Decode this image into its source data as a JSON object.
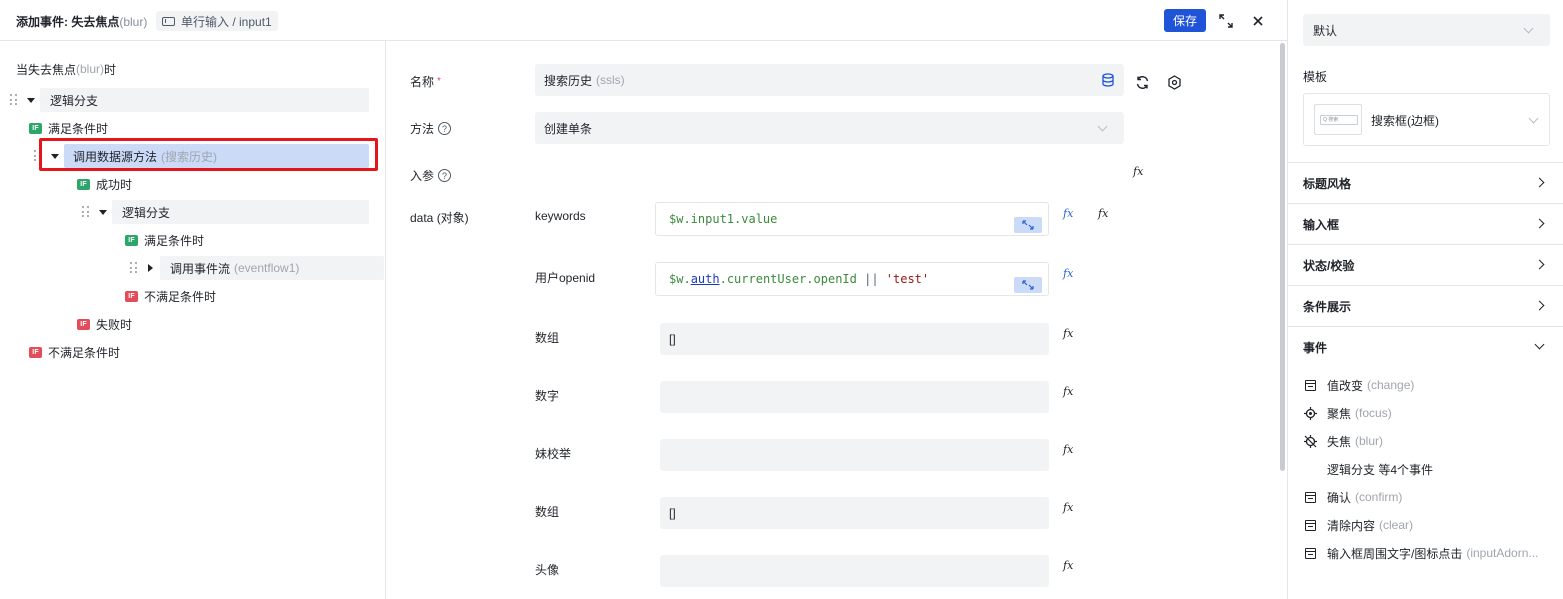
{
  "header": {
    "title": "添加事件: 失去焦点",
    "title_event": "(blur)",
    "context": "单行输入 / input1",
    "save_label": "保存"
  },
  "tree": {
    "heading": "当失去焦点",
    "heading_event": "(blur)",
    "heading_suffix": "时",
    "nodes": {
      "branch1": "逻辑分支",
      "cond_true": "满足条件时",
      "call_ds": "调用数据源方法",
      "call_ds_sub": "(搜索历史)",
      "success": "成功时",
      "branch2": "逻辑分支",
      "cond_true2": "满足条件时",
      "call_flow": "调用事件流",
      "call_flow_sub": "(eventflow1)",
      "cond_false2": "不满足条件时",
      "fail": "失败时",
      "cond_false": "不满足条件时"
    },
    "badge": "IF"
  },
  "form": {
    "name_label": "名称",
    "required_mark": "*",
    "name_value": "搜索历史",
    "name_sub": "(ssls)",
    "method_label": "方法",
    "method_value": "创建单条",
    "params_label": "入参",
    "data_label": "data (对象)",
    "fx": "fx",
    "params": [
      {
        "label": "keywords"
      },
      {
        "label": "用户openid"
      },
      {
        "label": "数组",
        "value": "[]"
      },
      {
        "label": "数字",
        "value": ""
      },
      {
        "label": "妹校举",
        "value": ""
      },
      {
        "label": "数组",
        "value": "[]"
      },
      {
        "label": "头像",
        "value": ""
      }
    ],
    "code_keywords": "$w.input1.value",
    "code_openid_a": "$w.",
    "code_openid_b": "auth",
    "code_openid_c": ".currentUser.openId",
    "code_openid_d": " || ",
    "code_openid_e": "'test'"
  },
  "right": {
    "select_value": "默认",
    "template_label": "模板",
    "template_value": "搜索框(边框)",
    "template_thumb_text": "Q 搜索",
    "sections": [
      "标题风格",
      "输入框",
      "状态/校验",
      "条件展示",
      "事件"
    ],
    "events": [
      {
        "name": "值改变",
        "sub": "(change)",
        "icon": "calendar-icon"
      },
      {
        "name": "聚焦",
        "sub": "(focus)",
        "icon": "focus-icon"
      },
      {
        "name": "失焦",
        "sub": "(blur)",
        "icon": "blur-icon"
      },
      {
        "name": "逻辑分支 等4个事件",
        "sub": "",
        "icon": ""
      },
      {
        "name": "确认",
        "sub": "(confirm)",
        "icon": "calendar-icon"
      },
      {
        "name": "清除内容",
        "sub": "(clear)",
        "icon": "calendar-icon"
      },
      {
        "name": "输入框周围文字/图标点击",
        "sub": "(inputAdorn...",
        "icon": "calendar-icon"
      }
    ]
  }
}
